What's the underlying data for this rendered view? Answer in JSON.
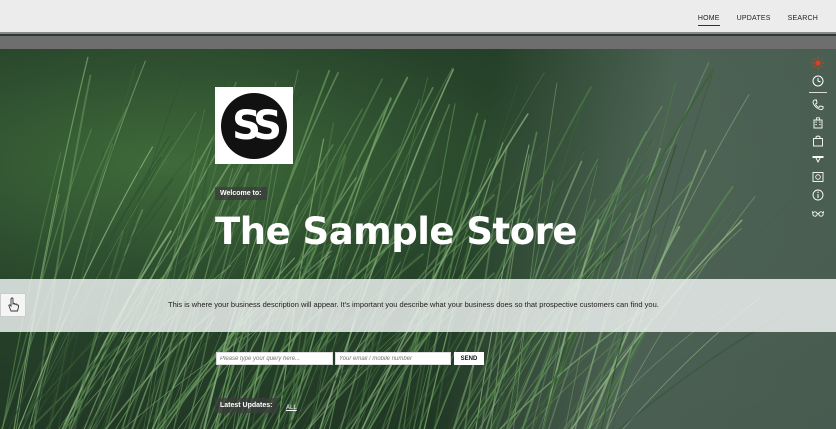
{
  "nav": {
    "items": [
      "HOME",
      "UPDATES",
      "SEARCH"
    ],
    "active": "HOME"
  },
  "hero": {
    "welcome": "Welcome to:",
    "title": "The Sample Store",
    "logo_text": "SS",
    "description": "This is where your business description will appear. It's important you describe what your business does so that prospective customers can find you."
  },
  "form": {
    "query_placeholder": "Please type your query here...",
    "contact_placeholder": "Your email / mobile number",
    "send_label": "SEND"
  },
  "updates": {
    "label": "Latest Updates:",
    "all_label": "ALL"
  },
  "sidebar_icons": [
    "sun-icon",
    "clock-icon",
    "phone-icon",
    "building-icon",
    "shopping-bag-icon",
    "bookmark-ribbon-icon",
    "photo-icon",
    "info-icon",
    "glasses-icon"
  ],
  "colors": {
    "accent": "#e23b1f",
    "topbar": "#ececec"
  }
}
